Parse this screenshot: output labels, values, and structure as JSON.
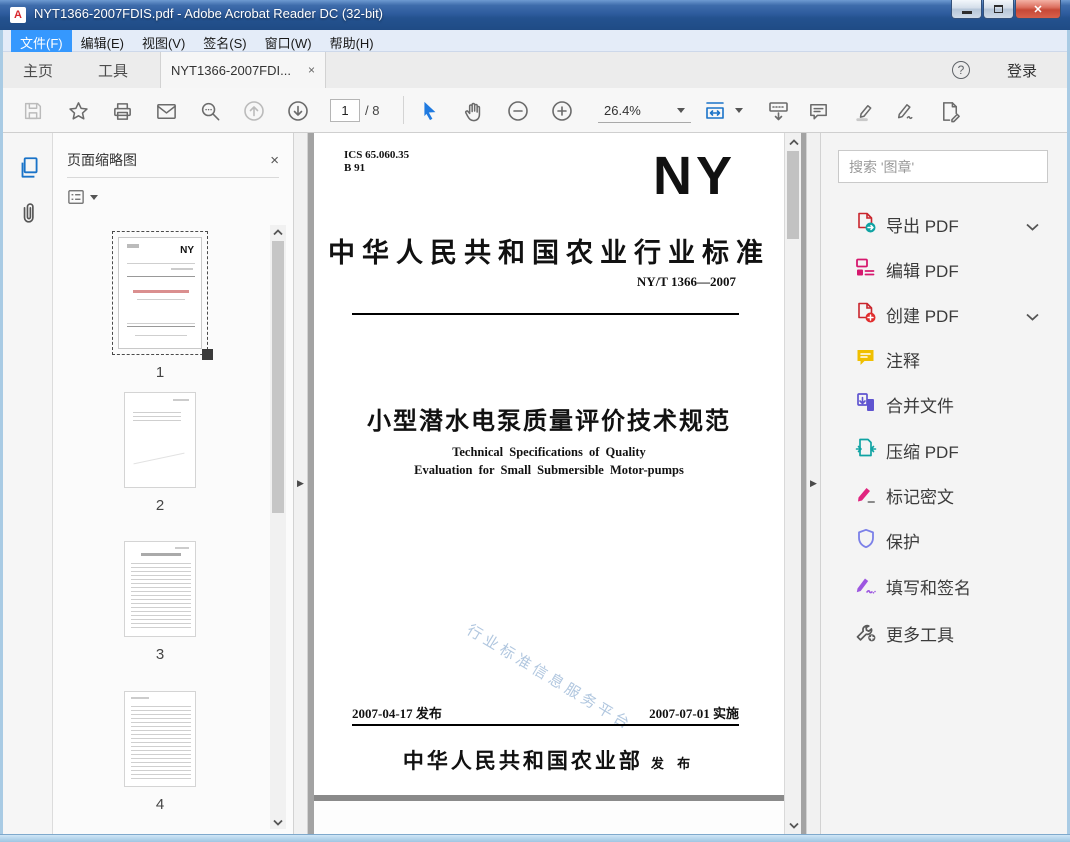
{
  "window": {
    "title": "NYT1366-2007FDIS.pdf - Adobe Acrobat Reader DC (32-bit)",
    "app_icon_letter": "A"
  },
  "menu": {
    "items": [
      "文件(F)",
      "编辑(E)",
      "视图(V)",
      "签名(S)",
      "窗口(W)",
      "帮助(H)"
    ]
  },
  "tabs": {
    "home": "主页",
    "tools": "工具",
    "document": "NYT1366-2007FDI...",
    "close": "×",
    "help": "?",
    "sign_in": "登录"
  },
  "toolbar": {
    "page_current": "1",
    "page_total": "/ 8",
    "zoom_level": "26.4%"
  },
  "left_panel": {
    "title": "页面缩略图",
    "close": "×",
    "thumbnails": [
      "1",
      "2",
      "3",
      "4"
    ],
    "collapse_arrow": "▶"
  },
  "pdf": {
    "ics_line1": "ICS 65.060.35",
    "ics_line2": "B 91",
    "logo": "NY",
    "header": "中华人民共和国农业行业标准",
    "standard_number": "NY/T 1366—2007",
    "title": "小型潜水电泵质量评价技术规范",
    "subtitle_en1": "Technical Specifications of Quality",
    "subtitle_en2": "Evaluation for Small Submersible Motor-pumps",
    "issue_date": "2007-04-17 发布",
    "implement_date": "2007-07-01 实施",
    "publisher": "中华人民共和国农业部",
    "publish_word": "发 布",
    "watermark": "行业标准信息服务平台"
  },
  "right_panel": {
    "search_placeholder": "搜索 '图章'",
    "collapse_arrow": "▶",
    "tools": [
      {
        "label": "导出 PDF",
        "expandable": true
      },
      {
        "label": "编辑 PDF",
        "expandable": false
      },
      {
        "label": "创建 PDF",
        "expandable": true
      },
      {
        "label": "注释",
        "expandable": false
      },
      {
        "label": "合并文件",
        "expandable": false
      },
      {
        "label": "压缩 PDF",
        "expandable": false
      },
      {
        "label": "标记密文",
        "expandable": false
      },
      {
        "label": "保护",
        "expandable": false
      },
      {
        "label": "填写和签名",
        "expandable": false
      },
      {
        "label": "更多工具",
        "expandable": false
      }
    ]
  },
  "colors": {
    "titlebar_blue": "#2e5c9e",
    "menu_highlight": "#3598fe",
    "toolbar_icon_gray": "#6b6b6b",
    "accent_blue": "#1a73c8",
    "doc_background": "#a3a3a3",
    "export_red": "#c9252d",
    "export_teal": "#0fa3a3",
    "edit_magenta": "#d6186e",
    "create_red": "#e12d2d",
    "comment_yellow": "#f0bf00",
    "combine_indigo": "#5f54d0",
    "compress_teal": "#0fa3a3",
    "redact_magenta": "#e0257f",
    "protect_indigo": "#7b80e8",
    "sign_purple": "#9d57e0",
    "watermark_blue": "#a9c1dc"
  }
}
